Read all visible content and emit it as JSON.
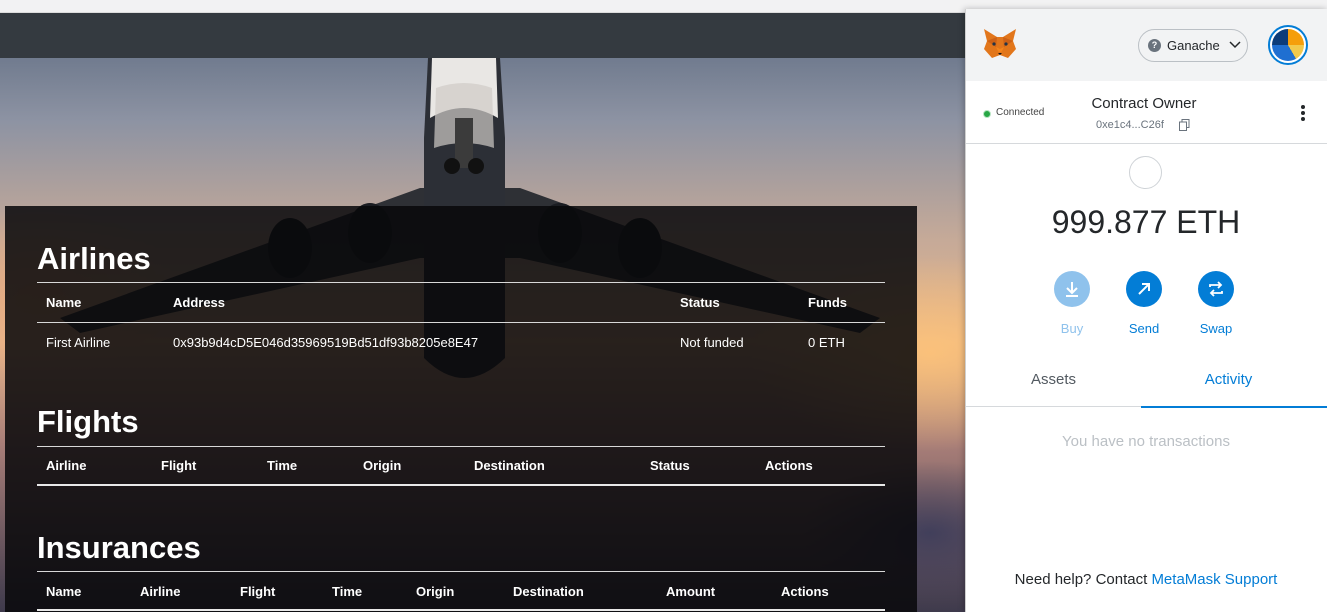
{
  "dapp": {
    "sections": {
      "airlines": {
        "title": "Airlines",
        "headers": [
          "Name",
          "Address",
          "Status",
          "Funds"
        ],
        "rows": [
          [
            "First Airline",
            "0x93b9d4cD5E046d35969519Bd51df93b8205e8E47",
            "Not funded",
            "0 ETH"
          ]
        ]
      },
      "flights": {
        "title": "Flights",
        "headers": [
          "Airline",
          "Flight",
          "Time",
          "Origin",
          "Destination",
          "Status",
          "Actions"
        ]
      },
      "insurances": {
        "title": "Insurances",
        "headers": [
          "Name",
          "Airline",
          "Flight",
          "Time",
          "Origin",
          "Destination",
          "Amount",
          "Actions"
        ]
      }
    }
  },
  "metamask": {
    "network": {
      "name": "Ganache",
      "help_icon": "?"
    },
    "account": {
      "status": "Connected",
      "name": "Contract Owner",
      "address": "0xe1c4...C26f"
    },
    "balance": "999.877 ETH",
    "actions": [
      {
        "label": "Buy",
        "icon": "download-icon",
        "disabled": true
      },
      {
        "label": "Send",
        "icon": "arrow-up-right-icon",
        "disabled": false
      },
      {
        "label": "Swap",
        "icon": "swap-icon",
        "disabled": false
      }
    ],
    "tabs": {
      "assets": "Assets",
      "activity": "Activity",
      "active": "Activity"
    },
    "empty_state": "You have no transactions",
    "help": {
      "text": "Need help? Contact",
      "link": "MetaMask Support"
    },
    "colors": {
      "accent": "#037dd6",
      "connected": "#28a745"
    }
  }
}
